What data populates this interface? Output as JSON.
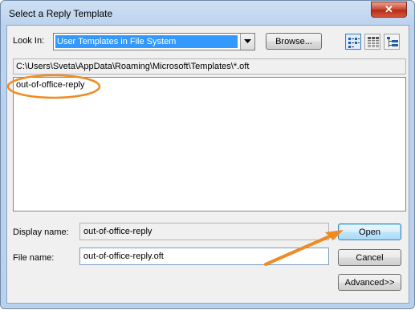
{
  "dialog": {
    "title": "Select a Reply Template",
    "close_glyph": "✕"
  },
  "look_in": {
    "label": "Look In:",
    "selected": "User Templates in File System",
    "browse_label": "Browse..."
  },
  "view_buttons": [
    "list-view-icon",
    "details-view-icon",
    "tree-view-icon"
  ],
  "path": "C:\\Users\\Sveta\\AppData\\Roaming\\Microsoft\\Templates\\*.oft",
  "files": [
    "out-of-office-reply"
  ],
  "display_name": {
    "label": "Display name:",
    "value": "out-of-office-reply"
  },
  "file_name": {
    "label": "File name:",
    "value": "out-of-office-reply.oft"
  },
  "buttons": {
    "open": "Open",
    "cancel": "Cancel",
    "advanced": "Advanced>>"
  },
  "colors": {
    "selection": "#3399ff",
    "annotation": "#f08a24",
    "title_bar": "#bcd3ee",
    "close_button": "#c9442c"
  }
}
